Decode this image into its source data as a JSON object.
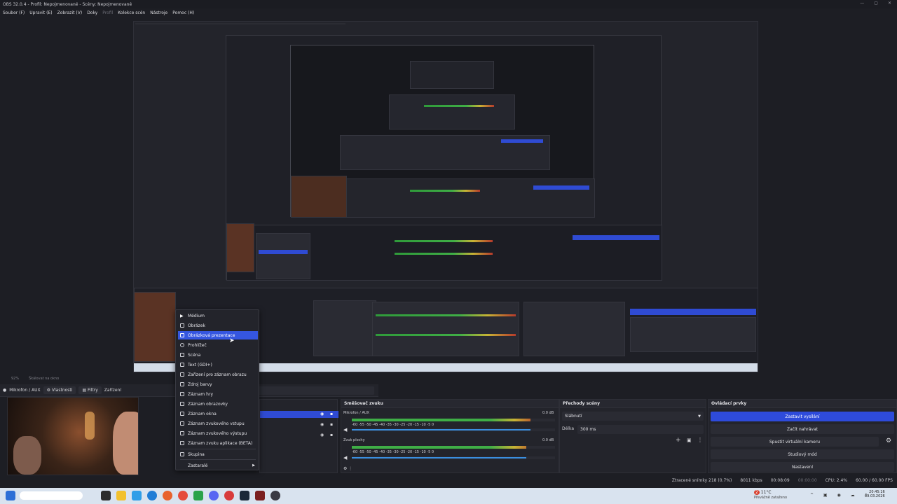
{
  "window": {
    "title": "OBS 32.0.4 - Profil: Nepojmenované - Scény: Nepojmenované",
    "controls": [
      "—",
      "▢",
      "✕"
    ]
  },
  "menubar": {
    "items": [
      {
        "label": "Soubor (F)",
        "dim": false
      },
      {
        "label": "Upravit (E)",
        "dim": false
      },
      {
        "label": "Zobrazit (V)",
        "dim": false
      },
      {
        "label": "Doky",
        "dim": false
      },
      {
        "label": "Profil",
        "dim": true
      },
      {
        "label": "Kolekce scén",
        "dim": false
      },
      {
        "label": "Nástroje",
        "dim": false
      },
      {
        "label": "Pomoc (H)",
        "dim": false
      }
    ]
  },
  "status_strip": {
    "zoom": "92%",
    "scale_hint": "Škálovat na okno"
  },
  "source_toolbar": {
    "source_name": "Mikrofon / AUX",
    "properties": "Vlastnosti",
    "filters": "Filtry",
    "device": "Zařízení"
  },
  "context_menu": {
    "items": [
      {
        "label": "Médium",
        "icon": "play-icon",
        "selected": false
      },
      {
        "label": "Obrázek",
        "icon": "image-icon",
        "selected": false
      },
      {
        "label": "Obrázková prezentace",
        "icon": "slideshow-icon",
        "selected": true
      },
      {
        "label": "Prohlížeč",
        "icon": "globe-icon",
        "selected": false
      },
      {
        "label": "Scéna",
        "icon": "scene-icon",
        "selected": false
      },
      {
        "label": "Text (GDI+)",
        "icon": "text-icon",
        "selected": false
      },
      {
        "label": "Zařízení pro záznam obrazu",
        "icon": "camera-icon",
        "selected": false
      },
      {
        "label": "Zdroj barvy",
        "icon": "palette-icon",
        "selected": false
      },
      {
        "label": "Záznam hry",
        "icon": "gamepad-icon",
        "selected": false
      },
      {
        "label": "Záznam obrazovky",
        "icon": "monitor-icon",
        "selected": false
      },
      {
        "label": "Záznam okna",
        "icon": "window-icon",
        "selected": false
      },
      {
        "label": "Záznam zvukového vstupu",
        "icon": "microphone-icon",
        "selected": false
      },
      {
        "label": "Záznam zvukového výstupu",
        "icon": "speaker-icon",
        "selected": false
      },
      {
        "label": "Záznam zvuku aplikace (BETA)",
        "icon": "app-audio-icon",
        "selected": false
      },
      {
        "label": "Skupina",
        "icon": "folder-icon",
        "selected": false
      },
      {
        "label": "Zastaralé",
        "icon": "",
        "selected": false
      }
    ]
  },
  "mixer": {
    "title": "Směšovač zvuku",
    "channels": [
      {
        "name": "Mikrofon / AUX",
        "db": "0.0 dB",
        "level": 0.88
      },
      {
        "name": "Zvuk plochy",
        "db": "0.0 dB",
        "level": 0.86
      }
    ],
    "ticks": [
      "-60",
      "-55",
      "-50",
      "-45",
      "-40",
      "-35",
      "-30",
      "-25",
      "-20",
      "-15",
      "-10",
      "-5",
      "0"
    ]
  },
  "transitions": {
    "title": "Přechody scény",
    "selected": "Slábnutí",
    "duration_label": "Délka",
    "duration_value": "300 ms"
  },
  "controls": {
    "title": "Ovládací prvky",
    "buttons": [
      {
        "label": "Zastavit vysílání",
        "primary": true
      },
      {
        "label": "Začít nahrávat",
        "primary": false
      },
      {
        "label": "Spustit virtuální kameru",
        "primary": false
      },
      {
        "label": "Studiový mód",
        "primary": false
      },
      {
        "label": "Nastavení",
        "primary": false
      }
    ]
  },
  "statusbar": {
    "dropped": "Ztracené snímky 218 (0.7%)",
    "bitrate": "8011 kbps",
    "live_time": "00:08:09",
    "rec_time": "00:00:00",
    "cpu": "CPU: 2.4%",
    "fps": "60.00 / 60.00 FPS"
  },
  "taskbar": {
    "weather_temp": "11°C",
    "weather_text": "Převážně zataženo",
    "clock_time": "20:45:16",
    "clock_date": "09.03.2026",
    "notification_count": "2"
  },
  "colors": {
    "accent": "#2e4bdb",
    "panel_bg": "#23242b",
    "window_bg": "#1d1e24",
    "meter_green": "#3fae46",
    "meter_yellow": "#c7b335",
    "meter_red": "#b53a2b"
  }
}
